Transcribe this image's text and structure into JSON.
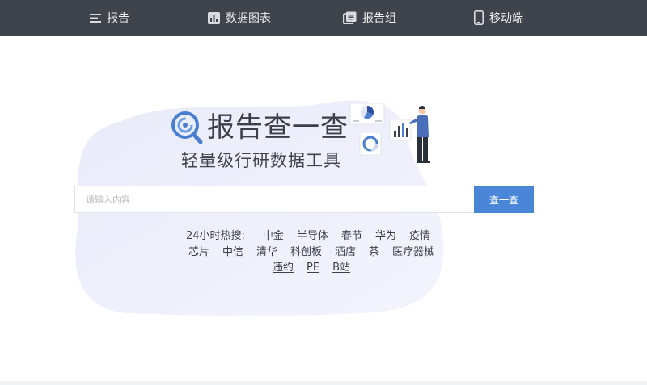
{
  "nav": {
    "items": [
      {
        "label": "报告",
        "icon": "list-icon"
      },
      {
        "label": "数据图表",
        "icon": "bar-chart-icon"
      },
      {
        "label": "报告组",
        "icon": "documents-icon"
      },
      {
        "label": "移动端",
        "icon": "mobile-phone-icon"
      }
    ]
  },
  "hero": {
    "title": "报告查一查",
    "subtitle": "轻量级行研数据工具"
  },
  "search": {
    "placeholder": "请输入内容",
    "button_label": "查一查"
  },
  "hot": {
    "label": "24小时热搜:",
    "tags": [
      "中金",
      "半导体",
      "春节",
      "华为",
      "疫情",
      "芯片",
      "中信",
      "清华",
      "科创板",
      "酒店",
      "茶",
      "医疗器械",
      "违约",
      "PE",
      "B站"
    ]
  },
  "colors": {
    "nav_bg": "#3f434b",
    "accent": "#4a86d8",
    "blob": "#eef0fb"
  }
}
